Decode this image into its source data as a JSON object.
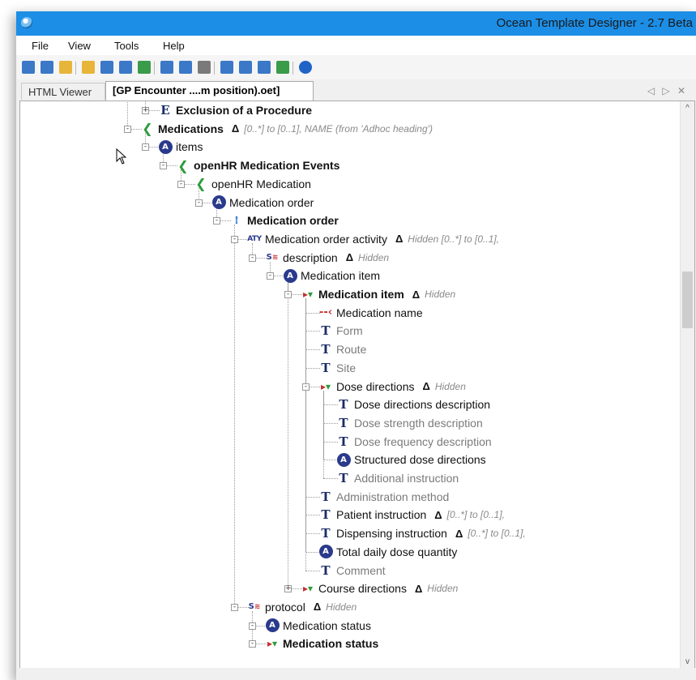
{
  "window": {
    "title": "Ocean Template Designer - 2.7 Beta"
  },
  "menu": [
    "File",
    "View",
    "Tools",
    "Help"
  ],
  "toolbar": {
    "buttons": [
      "new-icon",
      "new-template-icon",
      "new-archetype-icon",
      "open-icon",
      "save-icon",
      "save-all-icon",
      "refresh-icon",
      "tree-view-icon",
      "table-view-icon",
      "print-icon",
      "export-icon",
      "settings-icon",
      "document-icon",
      "package-icon",
      "help-icon"
    ],
    "colors": {
      "blue": "#3b78c8",
      "yellow": "#e7b53a",
      "green": "#3a9b4a",
      "grey": "#7a7a7a",
      "helpBlue": "#1f63c6"
    }
  },
  "tabs": [
    {
      "label": "HTML Viewer",
      "active": false
    },
    {
      "label": "[GP Encounter ....m position).oet]",
      "active": true
    }
  ],
  "tab_controls": "◁ ▷ ✕",
  "tree": [
    {
      "label": "Exclusion of a Procedure",
      "icon": "entry-icon",
      "bold": true
    },
    {
      "label": "Medications",
      "icon": "section-icon",
      "bold": true,
      "delta": "Δ",
      "constraint": "[0..*] to [0..1],  NAME (from 'Adhoc heading')"
    },
    {
      "label": "items",
      "icon": "archetype-slot-icon"
    },
    {
      "label": "openHR Medication Events",
      "icon": "section-icon",
      "bold": true
    },
    {
      "label": "openHR Medication",
      "icon": "section-icon"
    },
    {
      "label": "Medication order",
      "icon": "archetype-slot-icon"
    },
    {
      "label": "Medication order",
      "icon": "instruction-icon",
      "bold": true
    },
    {
      "label": "Medication order activity",
      "icon": "activity-icon",
      "delta": "Δ",
      "constraint": "Hidden [0..*] to [0..1],"
    },
    {
      "label": "description",
      "icon": "structure-icon",
      "delta": "Δ",
      "constraint": "Hidden"
    },
    {
      "label": "Medication item",
      "icon": "archetype-slot-icon"
    },
    {
      "label": "Medication item",
      "icon": "cluster-icon",
      "bold": true,
      "delta": "Δ",
      "constraint": "Hidden"
    },
    {
      "label": "Medication name",
      "icon": "name-element-icon"
    },
    {
      "label": "Form",
      "icon": "text-icon",
      "grey": true
    },
    {
      "label": "Route",
      "icon": "text-icon",
      "grey": true
    },
    {
      "label": "Site",
      "icon": "text-icon",
      "grey": true
    },
    {
      "label": "Dose directions",
      "icon": "cluster-icon",
      "delta": "Δ",
      "constraint": "Hidden"
    },
    {
      "label": "Dose directions description",
      "icon": "text-icon"
    },
    {
      "label": "Dose strength description",
      "icon": "text-icon",
      "grey": true
    },
    {
      "label": "Dose frequency description",
      "icon": "text-icon",
      "grey": true
    },
    {
      "label": "Structured dose directions",
      "icon": "archetype-slot-icon"
    },
    {
      "label": "Additional instruction",
      "icon": "text-icon",
      "grey": true
    },
    {
      "label": "Administration method",
      "icon": "text-icon",
      "grey": true
    },
    {
      "label": "Patient instruction",
      "icon": "text-icon",
      "delta": "Δ",
      "constraint": "[0..*] to [0..1],"
    },
    {
      "label": "Dispensing instruction",
      "icon": "text-icon",
      "delta": "Δ",
      "constraint": "[0..*] to [0..1],"
    },
    {
      "label": "Total daily dose quantity",
      "icon": "archetype-slot-icon"
    },
    {
      "label": "Comment",
      "icon": "text-icon",
      "grey": true
    },
    {
      "label": "Course directions",
      "icon": "cluster-icon",
      "delta": "Δ",
      "constraint": "Hidden"
    },
    {
      "label": "protocol",
      "icon": "structure-icon",
      "delta": "Δ",
      "constraint": "Hidden"
    },
    {
      "label": "Medication status",
      "icon": "archetype-slot-icon"
    },
    {
      "label": "Medication status",
      "icon": "cluster-icon",
      "bold": true
    }
  ]
}
